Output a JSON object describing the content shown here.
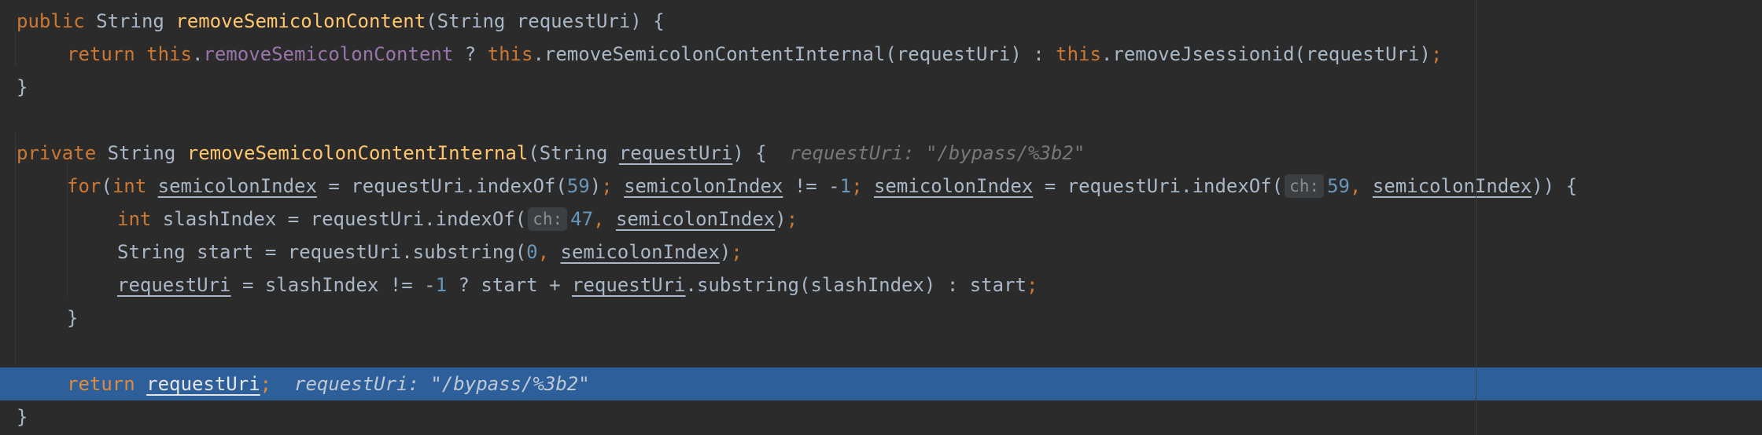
{
  "code": {
    "l1": {
      "public": "public",
      "type": "String",
      "name": "removeSemicolonContent",
      "params": "(String requestUri) {"
    },
    "l2": {
      "ret": "return",
      "this1": "this",
      "dot1": ".",
      "field": "removeSemicolonContent",
      "q": " ? ",
      "this2": "this",
      "call1": ".removeSemicolonContentInternal(requestUri) : ",
      "this3": "this",
      "call2": ".removeJsessionid(requestUri)",
      "semi": ";"
    },
    "l3": {
      "brace": "}"
    },
    "l5": {
      "private": "private",
      "type": "String",
      "name": "removeSemicolonContentInternal",
      "p1": "(String ",
      "param": "requestUri",
      "p2": ") {",
      "hint": "requestUri: \"/bypass/%3b2\""
    },
    "l6": {
      "for": "for",
      "open": "(",
      "int": "int",
      "var1": "semicolonIndex",
      "a1": " = requestUri.indexOf(",
      "n59": "59",
      "a2": ")",
      "s1": ";",
      "var2": "semicolonIndex",
      "a3": " != -",
      "n1": "1",
      "s2": ";",
      "var3": "semicolonIndex",
      "a4": " = requestUri.indexOf(",
      "inlay": "ch:",
      "n59b": "59",
      "comma": ",",
      "var4": "semicolonIndex",
      "a5": ")) {"
    },
    "l7": {
      "int": "int",
      "a1": " slashIndex = requestUri.indexOf(",
      "inlay": "ch:",
      "n47": "47",
      "comma": ",",
      "var": "semicolonIndex",
      "a2": ")",
      "semi": ";"
    },
    "l8": {
      "a1": "String start = requestUri.substring(",
      "n0": "0",
      "comma": ",",
      "var": "semicolonIndex",
      "a2": ")",
      "semi": ";"
    },
    "l9": {
      "var1": "requestUri",
      "a1": " = slashIndex != -",
      "n1": "1",
      "a2": " ? start + ",
      "var2": "requestUri",
      "a3": ".substring(slashIndex) : start",
      "semi": ";"
    },
    "l10": {
      "brace": "}"
    },
    "l12": {
      "ret": "return",
      "var": "requestUri",
      "semi": ";",
      "hint": "requestUri: \"/bypass/%3b2\""
    },
    "l13": {
      "brace": "}"
    }
  }
}
